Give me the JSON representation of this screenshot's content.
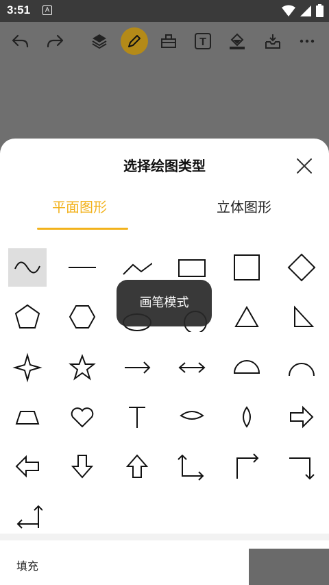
{
  "status_bar": {
    "time": "3:51",
    "notification_letter": "A"
  },
  "toolbar": {
    "items": [
      {
        "name": "undo-icon"
      },
      {
        "name": "redo-icon"
      },
      {
        "name": "layers-icon"
      },
      {
        "name": "pen-icon",
        "active": true
      },
      {
        "name": "eraser-icon"
      },
      {
        "name": "text-icon",
        "label": "T"
      },
      {
        "name": "fill-bucket-icon"
      },
      {
        "name": "save-tray-icon"
      },
      {
        "name": "more-icon"
      }
    ],
    "active_color": "#b48a18"
  },
  "sheet": {
    "title": "选择绘图类型",
    "tabs": [
      {
        "label": "平面图形",
        "active": true
      },
      {
        "label": "立体图形",
        "active": false
      }
    ],
    "accent_color": "#f2b21c",
    "shapes": [
      "freehand-wave",
      "line",
      "polyline",
      "rectangle",
      "square",
      "diamond",
      "pentagon",
      "hexagon",
      "ellipse",
      "circle",
      "triangle",
      "right-triangle",
      "four-point-star",
      "five-point-star",
      "arrow-right",
      "arrow-both",
      "semicircle",
      "arc",
      "trapezoid",
      "heart",
      "t-shape",
      "eye-lens",
      "leaf",
      "block-arrow-right",
      "block-arrow-left",
      "block-arrow-down",
      "block-arrow-up",
      "elbow-down-right",
      "elbow-up-right",
      "elbow-right-down",
      "elbow-left-up"
    ],
    "text_label": "T",
    "selected_shape": "freehand-wave",
    "toast": "画笔模式",
    "fill_label": "填充"
  }
}
